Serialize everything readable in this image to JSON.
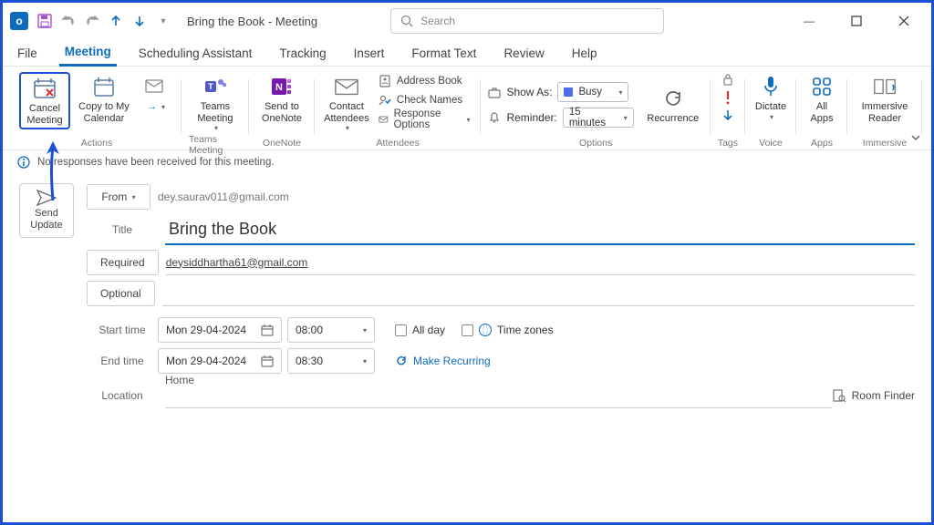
{
  "titlebar": {
    "title": "Bring the Book  -  Meeting",
    "search_placeholder": "Search"
  },
  "tabs": {
    "file": "File",
    "meeting": "Meeting",
    "scheduling": "Scheduling Assistant",
    "tracking": "Tracking",
    "insert": "Insert",
    "format": "Format Text",
    "review": "Review",
    "help": "Help"
  },
  "ribbon": {
    "cancel": "Cancel Meeting",
    "copy_cal": "Copy to My Calendar",
    "actions_group": "Actions",
    "teams": "Teams Meeting",
    "teams_group": "Teams Meeting",
    "onenote": "Send to OneNote",
    "onenote_group": "OneNote",
    "contact_attendees": "Contact Attendees",
    "address_book": "Address Book",
    "check_names": "Check Names",
    "response_options": "Response Options",
    "attendees_group": "Attendees",
    "show_as": "Show As:",
    "show_as_value": "Busy",
    "reminder": "Reminder:",
    "reminder_value": "15 minutes",
    "recurrence": "Recurrence",
    "options_group": "Options",
    "tags_group": "Tags",
    "dictate": "Dictate",
    "voice_group": "Voice",
    "all_apps": "All Apps",
    "apps_group": "Apps",
    "immersive": "Immersive Reader",
    "immersive_group": "Immersive"
  },
  "info_bar": "No responses have been received for this meeting.",
  "form": {
    "send": "Send Update",
    "from_label": "From",
    "from_value": "dey.saurav011@gmail.com",
    "title_label": "Title",
    "title_value": "Bring the Book",
    "required_label": "Required",
    "required_value": "deysiddhartha61@gmail.com",
    "optional_label": "Optional",
    "start_label": "Start time",
    "start_date": "Mon 29-04-2024",
    "start_time": "08:00",
    "end_label": "End time",
    "end_date": "Mon 29-04-2024",
    "end_time": "08:30",
    "all_day": "All day",
    "time_zones": "Time zones",
    "make_recurring": "Make Recurring",
    "location_label": "Location",
    "location_value": "Home",
    "room_finder": "Room Finder"
  }
}
